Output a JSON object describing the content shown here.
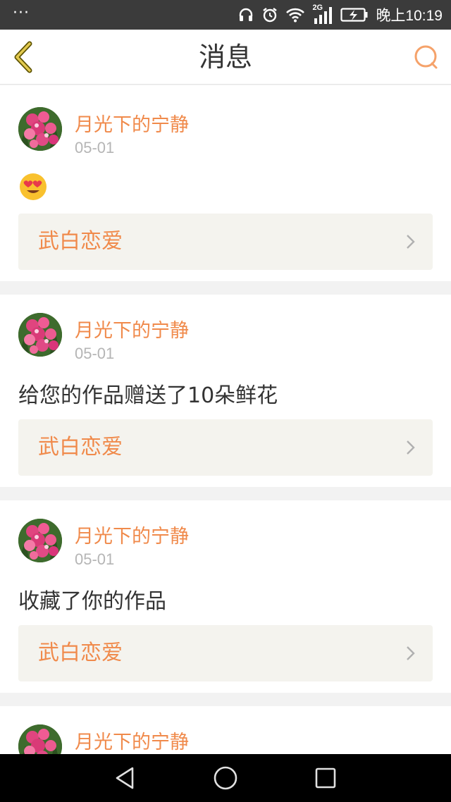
{
  "status_bar": {
    "dots": "···",
    "network": "2G",
    "time": "晚上10:19"
  },
  "header": {
    "title": "消息",
    "accent_color": "#f08a4b"
  },
  "messages": [
    {
      "username": "月光下的宁静",
      "date": "05-01",
      "content": "",
      "content_emoji": "heart-eyes-emoji",
      "work_title": "武白恋爱"
    },
    {
      "username": "月光下的宁静",
      "date": "05-01",
      "content": "给您的作品赠送了10朵鲜花",
      "work_title": "武白恋爱"
    },
    {
      "username": "月光下的宁静",
      "date": "05-01",
      "content": "收藏了你的作品",
      "work_title": "武白恋爱"
    },
    {
      "username": "月光下的宁静"
    }
  ]
}
